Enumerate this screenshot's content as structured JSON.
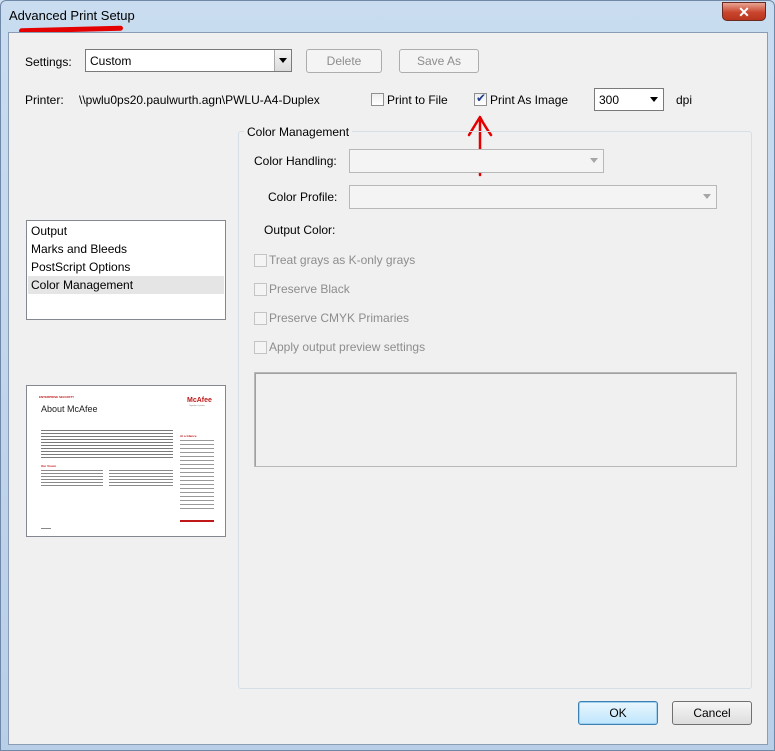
{
  "window": {
    "title": "Advanced Print Setup",
    "close_glyph": "✕"
  },
  "settings": {
    "label": "Settings:",
    "value": "Custom",
    "delete_label": "Delete",
    "save_as_label": "Save As"
  },
  "printer": {
    "label": "Printer:",
    "name": "\\\\pwlu0ps20.paulwurth.agn\\PWLU-A4-Duplex",
    "print_to_file_label": "Print to File",
    "print_to_file_checked": false,
    "print_as_image_label": "Print As Image",
    "print_as_image_checked": true,
    "dpi_value": "300",
    "dpi_label": "dpi"
  },
  "nav_list": {
    "items": [
      {
        "label": "Output"
      },
      {
        "label": "Marks and Bleeds"
      },
      {
        "label": "PostScript Options"
      },
      {
        "label": "Color Management",
        "selected": true
      }
    ]
  },
  "preview_page": {
    "header_tag": "ENTERPRISE SECURITY",
    "title": "About McAfee",
    "brand": "McAfee",
    "brand_tagline": "Together is power.",
    "section_heading": "Our Vision",
    "sidebar_heading": "At a Glance"
  },
  "color_management": {
    "group_title": "Color Management",
    "color_handling_label": "Color Handling:",
    "color_handling_value": "",
    "color_profile_label": "Color Profile:",
    "color_profile_value": "",
    "output_color_label": "Output Color:",
    "options": [
      {
        "label": "Treat grays as K-only grays",
        "checked": false
      },
      {
        "label": "Preserve Black",
        "checked": false
      },
      {
        "label": "Preserve CMYK Primaries",
        "checked": false
      },
      {
        "label": "Apply output preview settings",
        "checked": false
      }
    ]
  },
  "buttons": {
    "ok_label": "OK",
    "cancel_label": "Cancel"
  },
  "colors": {
    "annotation_red": "#e40000",
    "brand_red": "#c01818"
  }
}
